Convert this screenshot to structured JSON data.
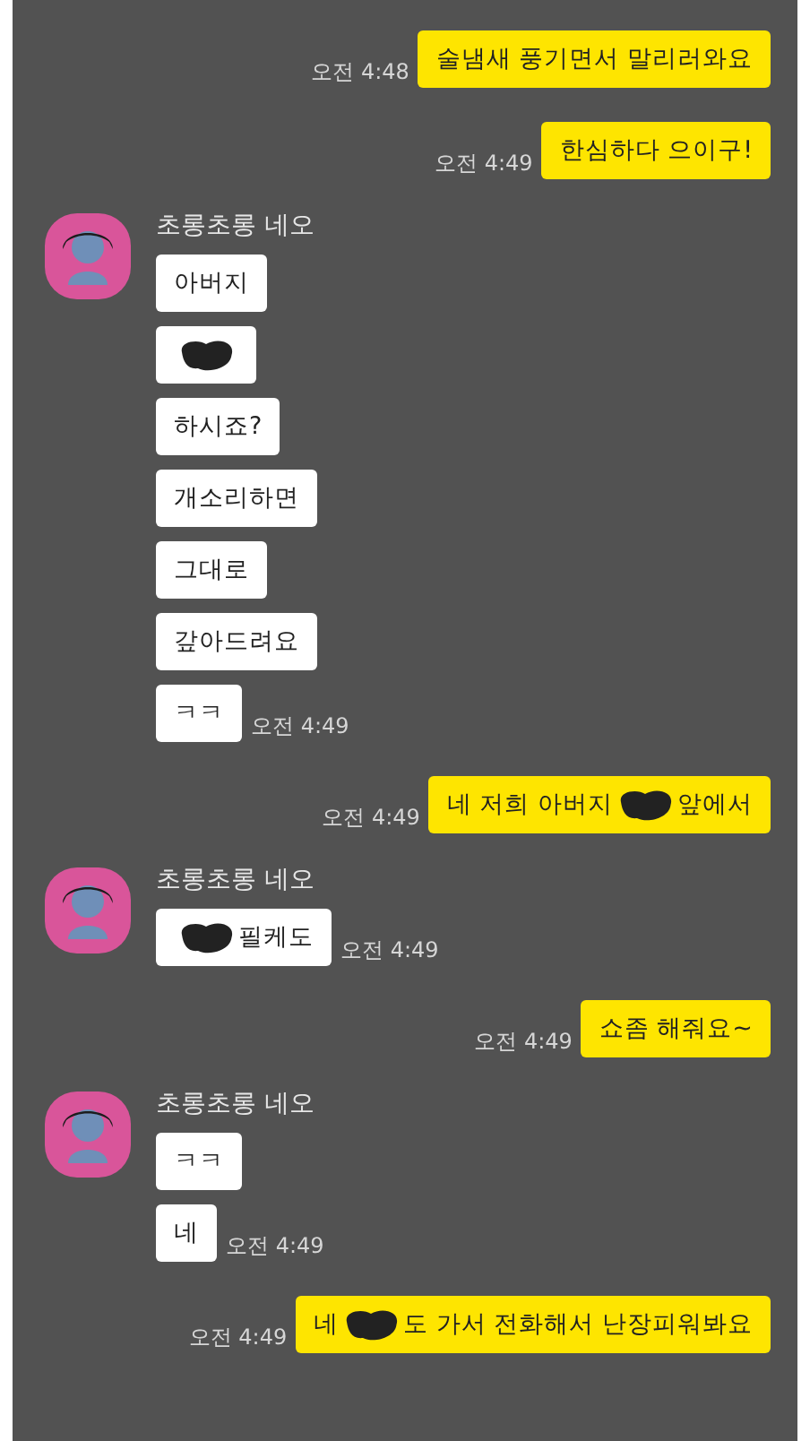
{
  "messages": [
    {
      "kind": "sent",
      "time": "오전 4:48",
      "bubbles": [
        {
          "parts": [
            {
              "kind": "text",
              "text": "술냄새 풍기면서 말리러와요"
            }
          ]
        }
      ]
    },
    {
      "kind": "sent",
      "time": "오전 4:49",
      "bubbles": [
        {
          "parts": [
            {
              "kind": "text",
              "text": "한심하다 으이구!"
            }
          ]
        }
      ]
    },
    {
      "kind": "received",
      "sender": "초롱초롱 네오",
      "time": "오전 4:49",
      "bubbles": [
        {
          "parts": [
            {
              "kind": "text",
              "text": "아버지"
            }
          ]
        },
        {
          "parts": [
            {
              "kind": "redaction"
            }
          ]
        },
        {
          "parts": [
            {
              "kind": "text",
              "text": "하시죠?"
            }
          ]
        },
        {
          "parts": [
            {
              "kind": "text",
              "text": "개소리하면"
            }
          ]
        },
        {
          "parts": [
            {
              "kind": "text",
              "text": "그대로"
            }
          ]
        },
        {
          "parts": [
            {
              "kind": "text",
              "text": "갚아드려요"
            }
          ]
        },
        {
          "parts": [
            {
              "kind": "text",
              "text": "ㅋㅋ"
            }
          ]
        }
      ]
    },
    {
      "kind": "sent",
      "time": "오전 4:49",
      "bubbles": [
        {
          "parts": [
            {
              "kind": "text",
              "text": "네 저희 아버지"
            },
            {
              "kind": "redaction"
            },
            {
              "kind": "text",
              "text": "앞에서"
            }
          ]
        }
      ]
    },
    {
      "kind": "received",
      "sender": "초롱초롱 네오",
      "time": "오전 4:49",
      "bubbles": [
        {
          "parts": [
            {
              "kind": "redaction"
            },
            {
              "kind": "text",
              "text": "필케도"
            }
          ]
        }
      ]
    },
    {
      "kind": "sent",
      "time": "오전 4:49",
      "bubbles": [
        {
          "parts": [
            {
              "kind": "text",
              "text": "쇼좀 해줘요~"
            }
          ]
        }
      ]
    },
    {
      "kind": "received",
      "sender": "초롱초롱 네오",
      "time": "오전 4:49",
      "bubbles": [
        {
          "parts": [
            {
              "kind": "text",
              "text": "ㅋㅋ"
            }
          ]
        },
        {
          "parts": [
            {
              "kind": "text",
              "text": "네"
            }
          ]
        }
      ]
    },
    {
      "kind": "sent",
      "time": "오전 4:49",
      "bubbles": [
        {
          "parts": [
            {
              "kind": "text",
              "text": "네"
            },
            {
              "kind": "redaction"
            },
            {
              "kind": "text",
              "text": "도 가서 전화해서 난장피워봐요"
            }
          ]
        }
      ]
    }
  ]
}
